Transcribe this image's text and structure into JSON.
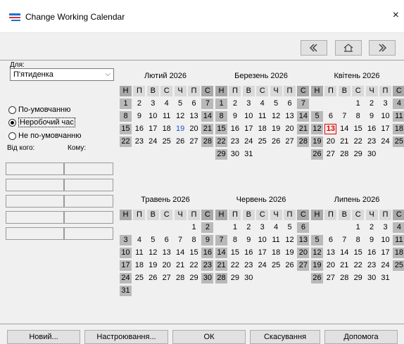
{
  "window": {
    "title": "Change Working Calendar",
    "close": "×"
  },
  "left": {
    "for_label": "Для:",
    "calendar_value": "П'ятиденка",
    "radios": [
      {
        "label": "По-умовчанню",
        "checked": false
      },
      {
        "label": "Неробочий час",
        "checked": true
      },
      {
        "label": "Не по-умовчанню",
        "checked": false
      }
    ],
    "from_label": "Від кого:",
    "to_label": "Кому:"
  },
  "weekday_headers": [
    "Н",
    "П",
    "В",
    "С",
    "Ч",
    "П",
    "С"
  ],
  "months": [
    {
      "title": "Лютий 2026",
      "start": 1,
      "days": 28
    },
    {
      "title": "Березень 2026",
      "start": 1,
      "days": 31
    },
    {
      "title": "Квітень 2026",
      "start": 4,
      "days": 30
    },
    {
      "title": "Травень 2026",
      "start": 6,
      "days": 31
    },
    {
      "title": "Червень 2026",
      "start": 2,
      "days": 30
    },
    {
      "title": "Липень 2026",
      "start": 4,
      "days": 31
    }
  ],
  "highlights": {
    "blue_day": {
      "month": 0,
      "day": 19
    },
    "today": {
      "month": 2,
      "day": 13
    }
  },
  "buttons": {
    "new": "Новий...",
    "settings": "Настроювання...",
    "ok": "ОК",
    "cancel": "Скасування",
    "help": "Допомога"
  },
  "colors": {
    "today_red": "#e00000",
    "blue_day": "#1a53c9",
    "weekend_gray": "#b9b9b9"
  }
}
